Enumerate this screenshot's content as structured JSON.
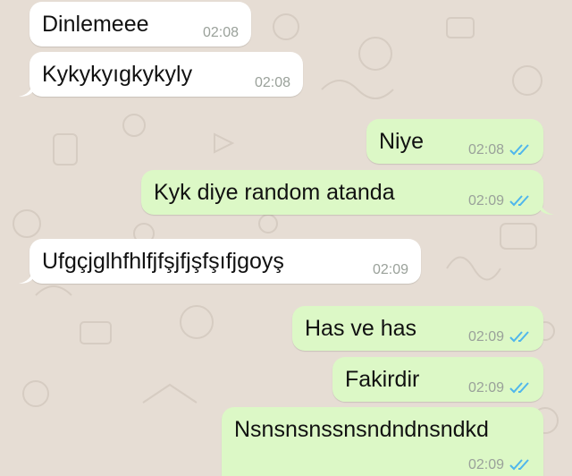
{
  "colors": {
    "background": "#e6ddd4",
    "incoming_bubble": "#ffffff",
    "outgoing_bubble": "#dcf8c6",
    "read_ticks": "#4fb6ec",
    "timestamp": "#9aa19a"
  },
  "messages": [
    {
      "text": "Dinlemeee",
      "time": "02:08",
      "direction": "incoming"
    },
    {
      "text": "Kykykyıgkykyly",
      "time": "02:08",
      "direction": "incoming"
    },
    {
      "text": "Niye",
      "time": "02:08",
      "direction": "outgoing",
      "status_icon": "double-check-read-icon"
    },
    {
      "text": "Kyk diye random atanda",
      "time": "02:09",
      "direction": "outgoing",
      "status_icon": "double-check-read-icon"
    },
    {
      "text": "Ufgçjglhfhlfjfşjfjşfşıfjgoyş",
      "time": "02:09",
      "direction": "incoming"
    },
    {
      "text": "Has ve has",
      "time": "02:09",
      "direction": "outgoing",
      "status_icon": "double-check-read-icon"
    },
    {
      "text": "Fakirdir",
      "time": "02:09",
      "direction": "outgoing",
      "status_icon": "double-check-read-icon"
    },
    {
      "text": "Nsnsnsnssnsndndnsndkd",
      "time": "02:09",
      "direction": "outgoing",
      "status_icon": "double-check-read-icon"
    }
  ]
}
